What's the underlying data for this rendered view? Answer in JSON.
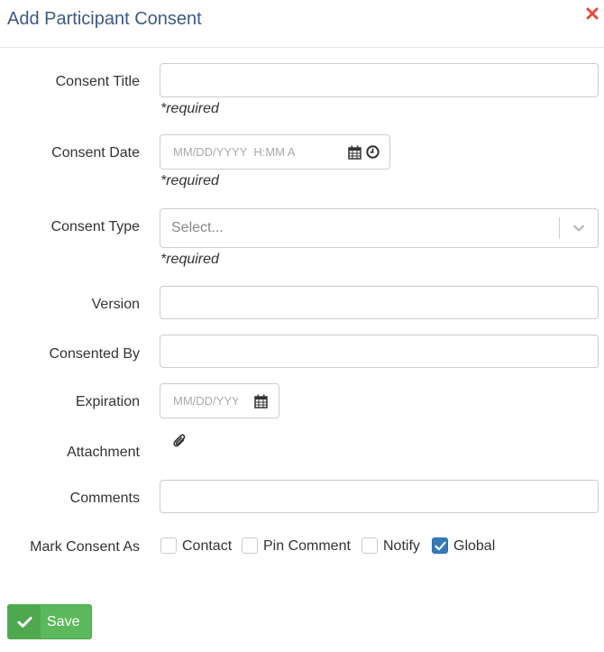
{
  "header": {
    "title": "Add Participant Consent",
    "close_color": "#e74c3c"
  },
  "form": {
    "consent_title": {
      "label": "Consent Title",
      "value": "",
      "hint": "*required"
    },
    "consent_date": {
      "label": "Consent Date",
      "placeholder": "MM/DD/YYYY  H:MM A",
      "hint": "*required",
      "icons": [
        "calendar-icon",
        "clock-icon"
      ]
    },
    "consent_type": {
      "label": "Consent Type",
      "value": "Select...",
      "hint": "*required"
    },
    "version": {
      "label": "Version",
      "value": ""
    },
    "consented_by": {
      "label": "Consented By",
      "value": ""
    },
    "expiration": {
      "label": "Expiration",
      "placeholder": "MM/DD/YYYY",
      "icons": [
        "calendar-icon"
      ]
    },
    "attachment": {
      "label": "Attachment",
      "icon": "paperclip-icon"
    },
    "comments": {
      "label": "Comments",
      "value": ""
    },
    "mark_as": {
      "label": "Mark Consent As",
      "options": [
        {
          "label": "Contact",
          "checked": false
        },
        {
          "label": "Pin Comment",
          "checked": false
        },
        {
          "label": "Notify",
          "checked": false
        },
        {
          "label": "Global",
          "checked": true
        }
      ]
    }
  },
  "footer": {
    "save_label": "Save",
    "save_color": "#5cb85c"
  }
}
